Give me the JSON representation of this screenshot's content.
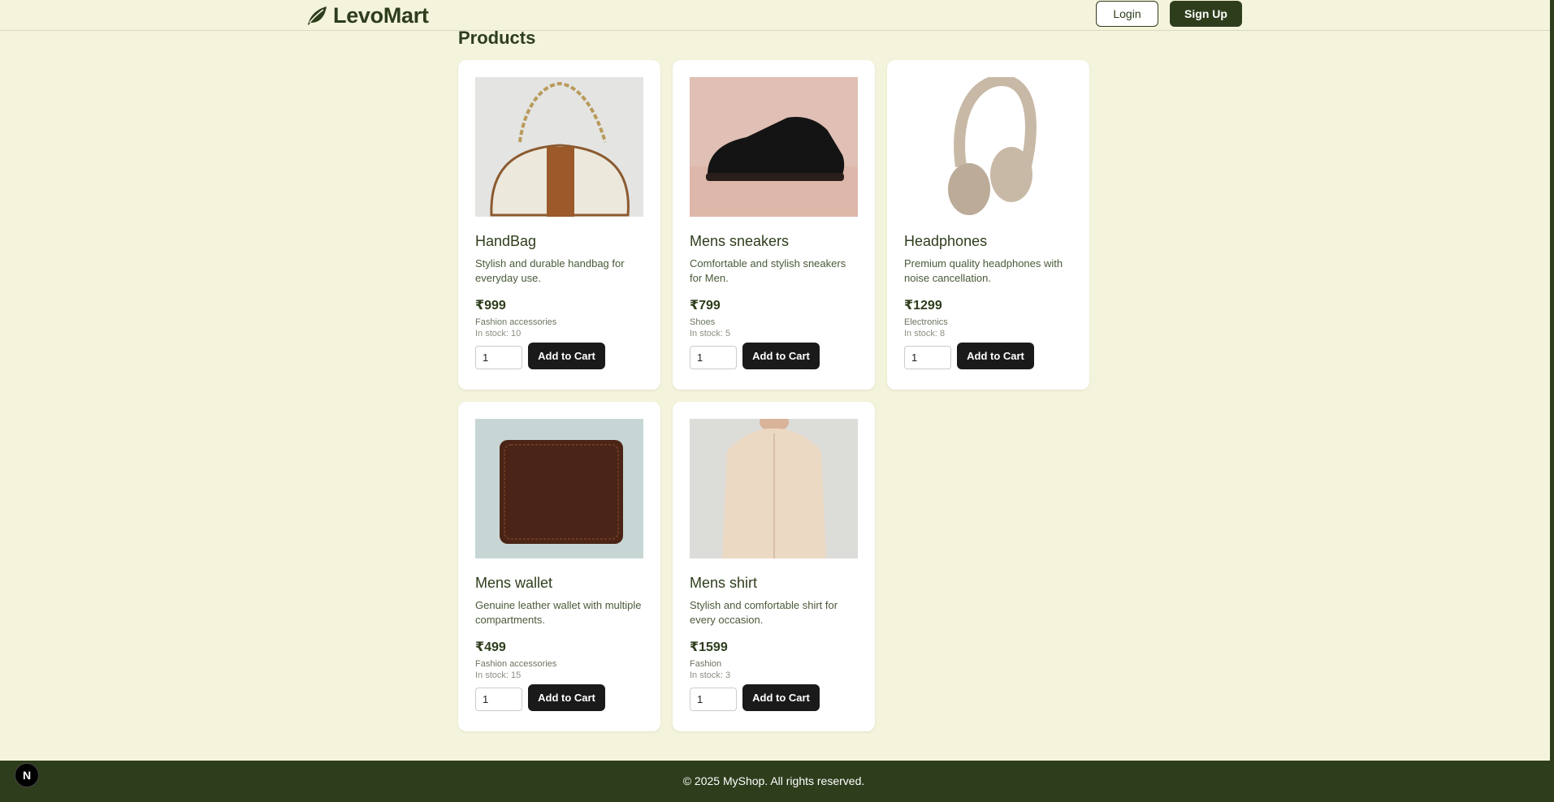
{
  "header": {
    "brand": "LevoMart",
    "logo_icon": "leaf-icon",
    "login_label": "Login",
    "signup_label": "Sign Up"
  },
  "main": {
    "title": "Products",
    "add_label": "Add to Cart",
    "products": [
      {
        "name": "HandBag",
        "description": "Stylish and durable handbag for everyday use.",
        "price": "₹999",
        "category": "Fashion accessories",
        "stock": "In stock: 10",
        "qty": "1"
      },
      {
        "name": "Mens sneakers",
        "description": "Comfortable and stylish sneakers for Men.",
        "price": "₹799",
        "category": "Shoes",
        "stock": "In stock: 5",
        "qty": "1"
      },
      {
        "name": "Headphones",
        "description": "Premium quality headphones with noise cancellation.",
        "price": "₹1299",
        "category": "Electronics",
        "stock": "In stock: 8",
        "qty": "1"
      },
      {
        "name": "Mens wallet",
        "description": "Genuine leather wallet with multiple compartments.",
        "price": "₹499",
        "category": "Fashion accessories",
        "stock": "In stock: 15",
        "qty": "1"
      },
      {
        "name": "Mens shirt",
        "description": "Stylish and comfortable shirt for every occasion.",
        "price": "₹1599",
        "category": "Fashion",
        "stock": "In stock: 3",
        "qty": "1"
      }
    ]
  },
  "footer": {
    "text": "© 2025 MyShop. All rights reserved."
  },
  "dev_badge": "N",
  "colors": {
    "background": "#f4f4dc",
    "brand_dark": "#2e3d1c",
    "button_dark": "#1a1a1a"
  }
}
